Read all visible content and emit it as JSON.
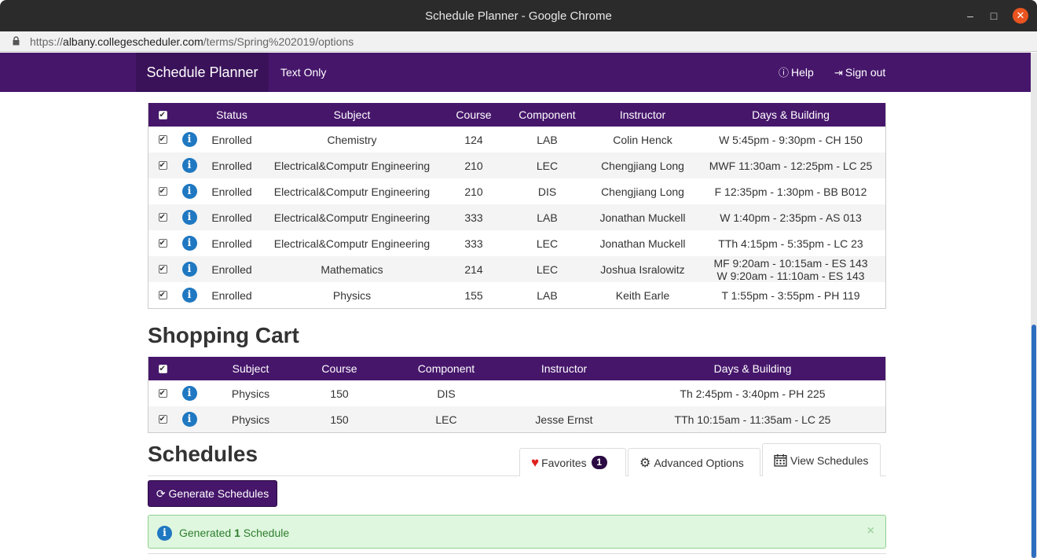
{
  "browser": {
    "window_title": "Schedule Planner - Google Chrome",
    "url_prefix": "https://",
    "url_host": "albany.collegescheduler.com",
    "url_path": "/terms/Spring%202019/options"
  },
  "nav": {
    "brand": "Schedule Planner",
    "text_only": "Text Only",
    "help": "Help",
    "sign_out": "Sign out"
  },
  "enrolled": {
    "headers": [
      "Status",
      "Subject",
      "Course",
      "Component",
      "Instructor",
      "Days & Building"
    ],
    "rows": [
      {
        "status": "Enrolled",
        "subject": "Chemistry",
        "course": "124",
        "component": "LAB",
        "instructor": "Colin Henck",
        "days": [
          "W 5:45pm - 9:30pm - CH 150"
        ]
      },
      {
        "status": "Enrolled",
        "subject": "Electrical&Computr Engineering",
        "course": "210",
        "component": "LEC",
        "instructor": "Chengjiang Long",
        "days": [
          "MWF 11:30am - 12:25pm - LC 25"
        ]
      },
      {
        "status": "Enrolled",
        "subject": "Electrical&Computr Engineering",
        "course": "210",
        "component": "DIS",
        "instructor": "Chengjiang Long",
        "days": [
          "F 12:35pm - 1:30pm - BB B012"
        ]
      },
      {
        "status": "Enrolled",
        "subject": "Electrical&Computr Engineering",
        "course": "333",
        "component": "LAB",
        "instructor": "Jonathan Muckell",
        "days": [
          "W 1:40pm - 2:35pm - AS 013"
        ]
      },
      {
        "status": "Enrolled",
        "subject": "Electrical&Computr Engineering",
        "course": "333",
        "component": "LEC",
        "instructor": "Jonathan Muckell",
        "days": [
          "TTh 4:15pm - 5:35pm - LC 23"
        ]
      },
      {
        "status": "Enrolled",
        "subject": "Mathematics",
        "course": "214",
        "component": "LEC",
        "instructor": "Joshua Isralowitz",
        "days": [
          "MF 9:20am - 10:15am - ES 143",
          "W 9:20am - 11:10am - ES 143"
        ]
      },
      {
        "status": "Enrolled",
        "subject": "Physics",
        "course": "155",
        "component": "LAB",
        "instructor": "Keith Earle",
        "days": [
          "T 1:55pm - 3:55pm - PH 119"
        ]
      }
    ]
  },
  "cart": {
    "title": "Shopping Cart",
    "headers": [
      "Subject",
      "Course",
      "Component",
      "Instructor",
      "Days & Building"
    ],
    "rows": [
      {
        "subject": "Physics",
        "course": "150",
        "component": "DIS",
        "instructor": "",
        "days": "Th 2:45pm - 3:40pm - PH 225"
      },
      {
        "subject": "Physics",
        "course": "150",
        "component": "LEC",
        "instructor": "Jesse Ernst",
        "days": "TTh 10:15am - 11:35am - LC 25"
      }
    ]
  },
  "schedules": {
    "title": "Schedules",
    "tabs": {
      "favorites": "Favorites",
      "favorites_count": "1",
      "advanced": "Advanced Options",
      "view": "View Schedules"
    },
    "generate_button": "Generate Schedules",
    "alert": {
      "prefix": "Generated",
      "count": "1",
      "suffix": "Schedule"
    }
  },
  "colors": {
    "primary": "#46166b",
    "info_icon": "#1f78c1",
    "success_bg": "#dff7df",
    "heart": "#e0201d"
  }
}
